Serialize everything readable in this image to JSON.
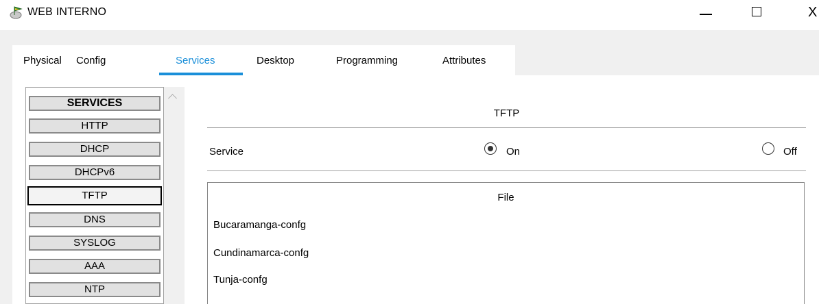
{
  "window": {
    "title": "WEB INTERNO",
    "controls": {
      "minimize": "minimize-icon",
      "maximize": "maximize-icon",
      "close": "close-icon",
      "close_glyph": "X"
    }
  },
  "tabs": [
    {
      "label": "Physical",
      "active": false
    },
    {
      "label": "Config",
      "active": false
    },
    {
      "label": "Services",
      "active": true
    },
    {
      "label": "Desktop",
      "active": false
    },
    {
      "label": "Programming",
      "active": false
    },
    {
      "label": "Attributes",
      "active": false
    }
  ],
  "services": {
    "header": "SERVICES",
    "items": [
      {
        "label": "HTTP",
        "selected": false
      },
      {
        "label": "DHCP",
        "selected": false
      },
      {
        "label": "DHCPv6",
        "selected": false
      },
      {
        "label": "TFTP",
        "selected": true
      },
      {
        "label": "DNS",
        "selected": false
      },
      {
        "label": "SYSLOG",
        "selected": false
      },
      {
        "label": "AAA",
        "selected": false
      },
      {
        "label": "NTP",
        "selected": false
      }
    ]
  },
  "tftp": {
    "title": "TFTP",
    "service_label": "Service",
    "on_label": "On",
    "off_label": "Off",
    "selected": "On",
    "file_header": "File",
    "files": [
      "Bucaramanga-confg",
      "Cundinamarca-confg",
      "Tunja-confg"
    ]
  },
  "colors": {
    "accent": "#1a8fd9",
    "chrome_gray": "#f0f0f0",
    "button_gray": "#e1e1e1"
  }
}
